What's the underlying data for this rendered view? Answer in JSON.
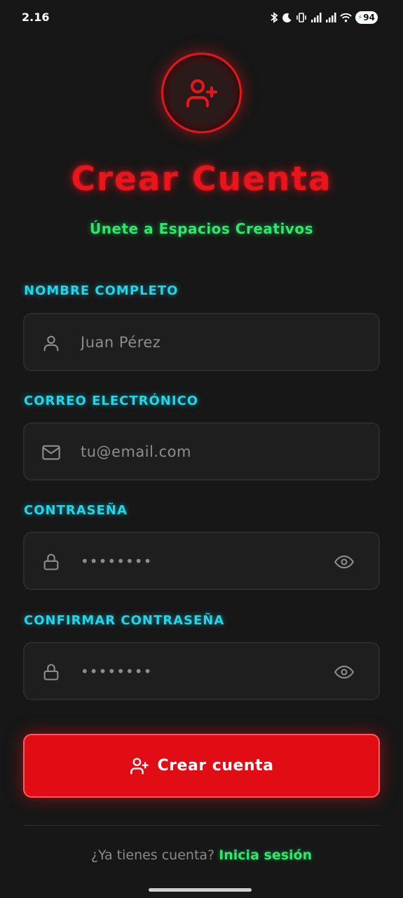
{
  "status_bar": {
    "time": "2.16",
    "battery": "94",
    "icons": [
      "bluetooth-icon",
      "moon-icon",
      "vibrate-icon",
      "signal-icon",
      "signal-icon",
      "wifi-icon",
      "battery-icon"
    ]
  },
  "header": {
    "avatar_icon": "user-plus-icon",
    "title": "Crear Cuenta",
    "subtitle": "Únete a Espacios Creativos"
  },
  "form": {
    "name": {
      "label": "NOMBRE COMPLETO",
      "placeholder": "Juan Pérez",
      "icon": "user-icon"
    },
    "email": {
      "label": "CORREO ELECTRÓNICO",
      "placeholder": "tu@email.com",
      "icon": "mail-icon"
    },
    "password": {
      "label": "CONTRASEÑA",
      "value": "••••••••",
      "icon": "lock-icon",
      "toggle_icon": "eye-icon"
    },
    "confirm_password": {
      "label": "CONFIRMAR CONTRASEÑA",
      "value": "••••••••",
      "icon": "lock-icon",
      "toggle_icon": "eye-icon"
    },
    "submit_label": "Crear cuenta",
    "submit_icon": "user-plus-icon"
  },
  "footer": {
    "question": "¿Ya tienes cuenta?",
    "login_link": "Inicia sesión"
  },
  "colors": {
    "background": "#171717",
    "accent_red": "#e10c14",
    "accent_green": "#2ee86e",
    "accent_cyan": "#1fd7ea",
    "field_bg": "#1e1e1e"
  }
}
